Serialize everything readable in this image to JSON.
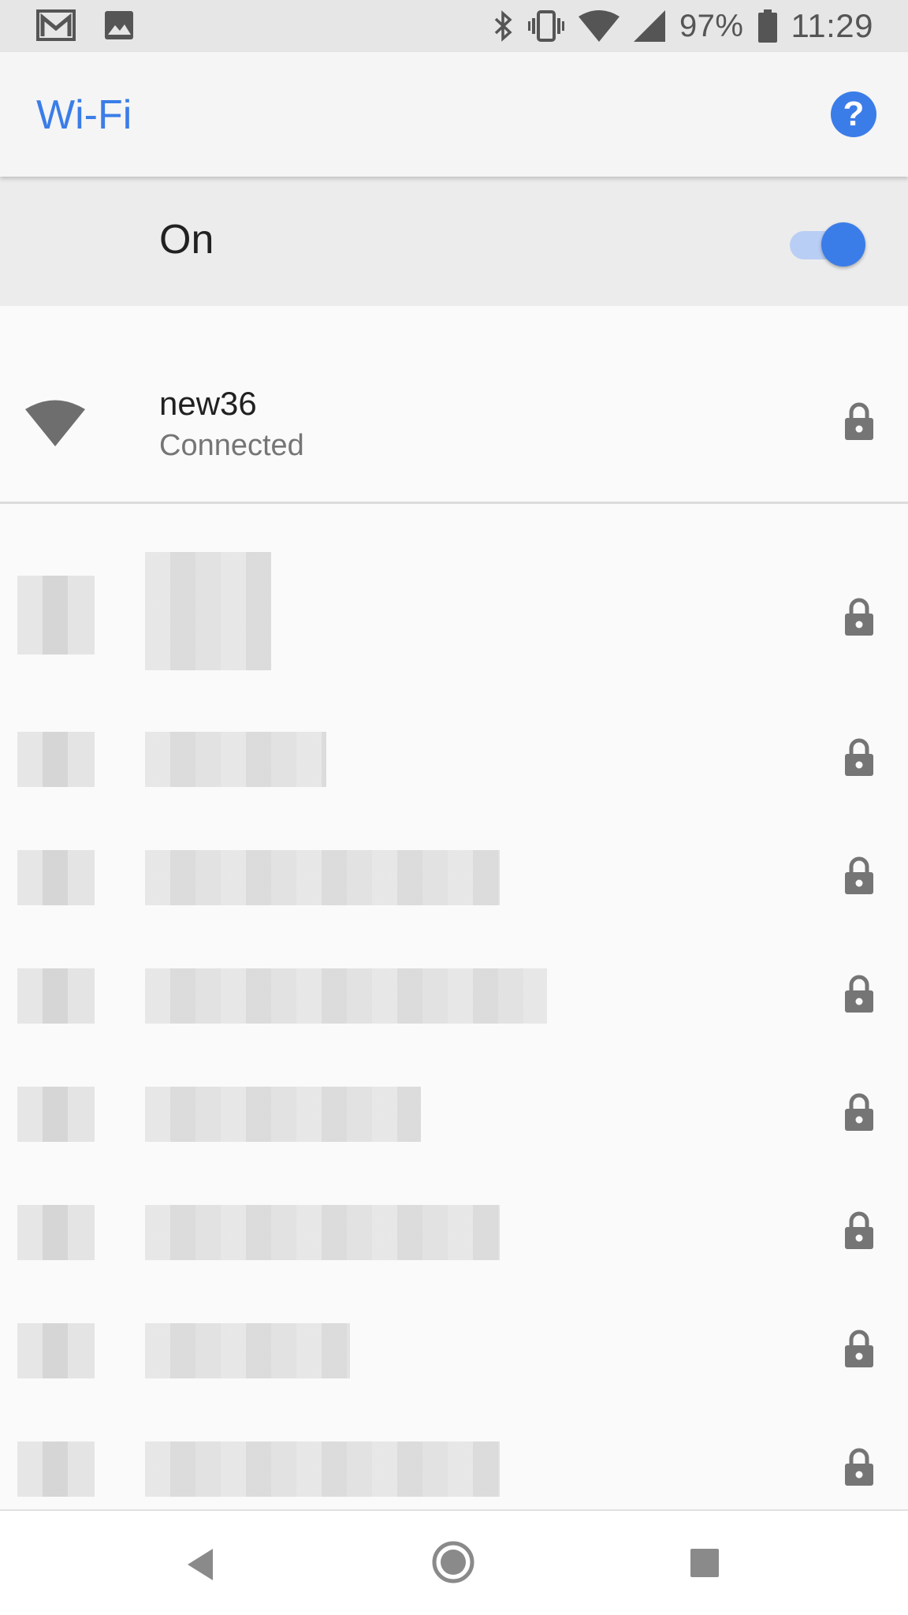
{
  "status_bar": {
    "left_icons": [
      "gmail-icon",
      "image-icon"
    ],
    "right_icons": [
      "bluetooth-icon",
      "vibrate-icon",
      "wifi-icon",
      "signal-icon",
      "battery-icon"
    ],
    "battery_percent": "97%",
    "time": "11:29"
  },
  "app_bar": {
    "title": "Wi-Fi",
    "help_icon": "help-icon",
    "help_glyph": "?"
  },
  "master_toggle": {
    "label": "On",
    "state": true,
    "accent_color": "#3b7de8"
  },
  "connected_network": {
    "name": "new36",
    "status": "Connected",
    "secured": true
  },
  "other_networks": {
    "count_visible": 8,
    "names_obscured": true,
    "secured": [
      true,
      true,
      true,
      true,
      true,
      true,
      true,
      true
    ]
  },
  "nav_bar": {
    "icons": [
      "back-icon",
      "home-icon",
      "recents-icon"
    ]
  }
}
